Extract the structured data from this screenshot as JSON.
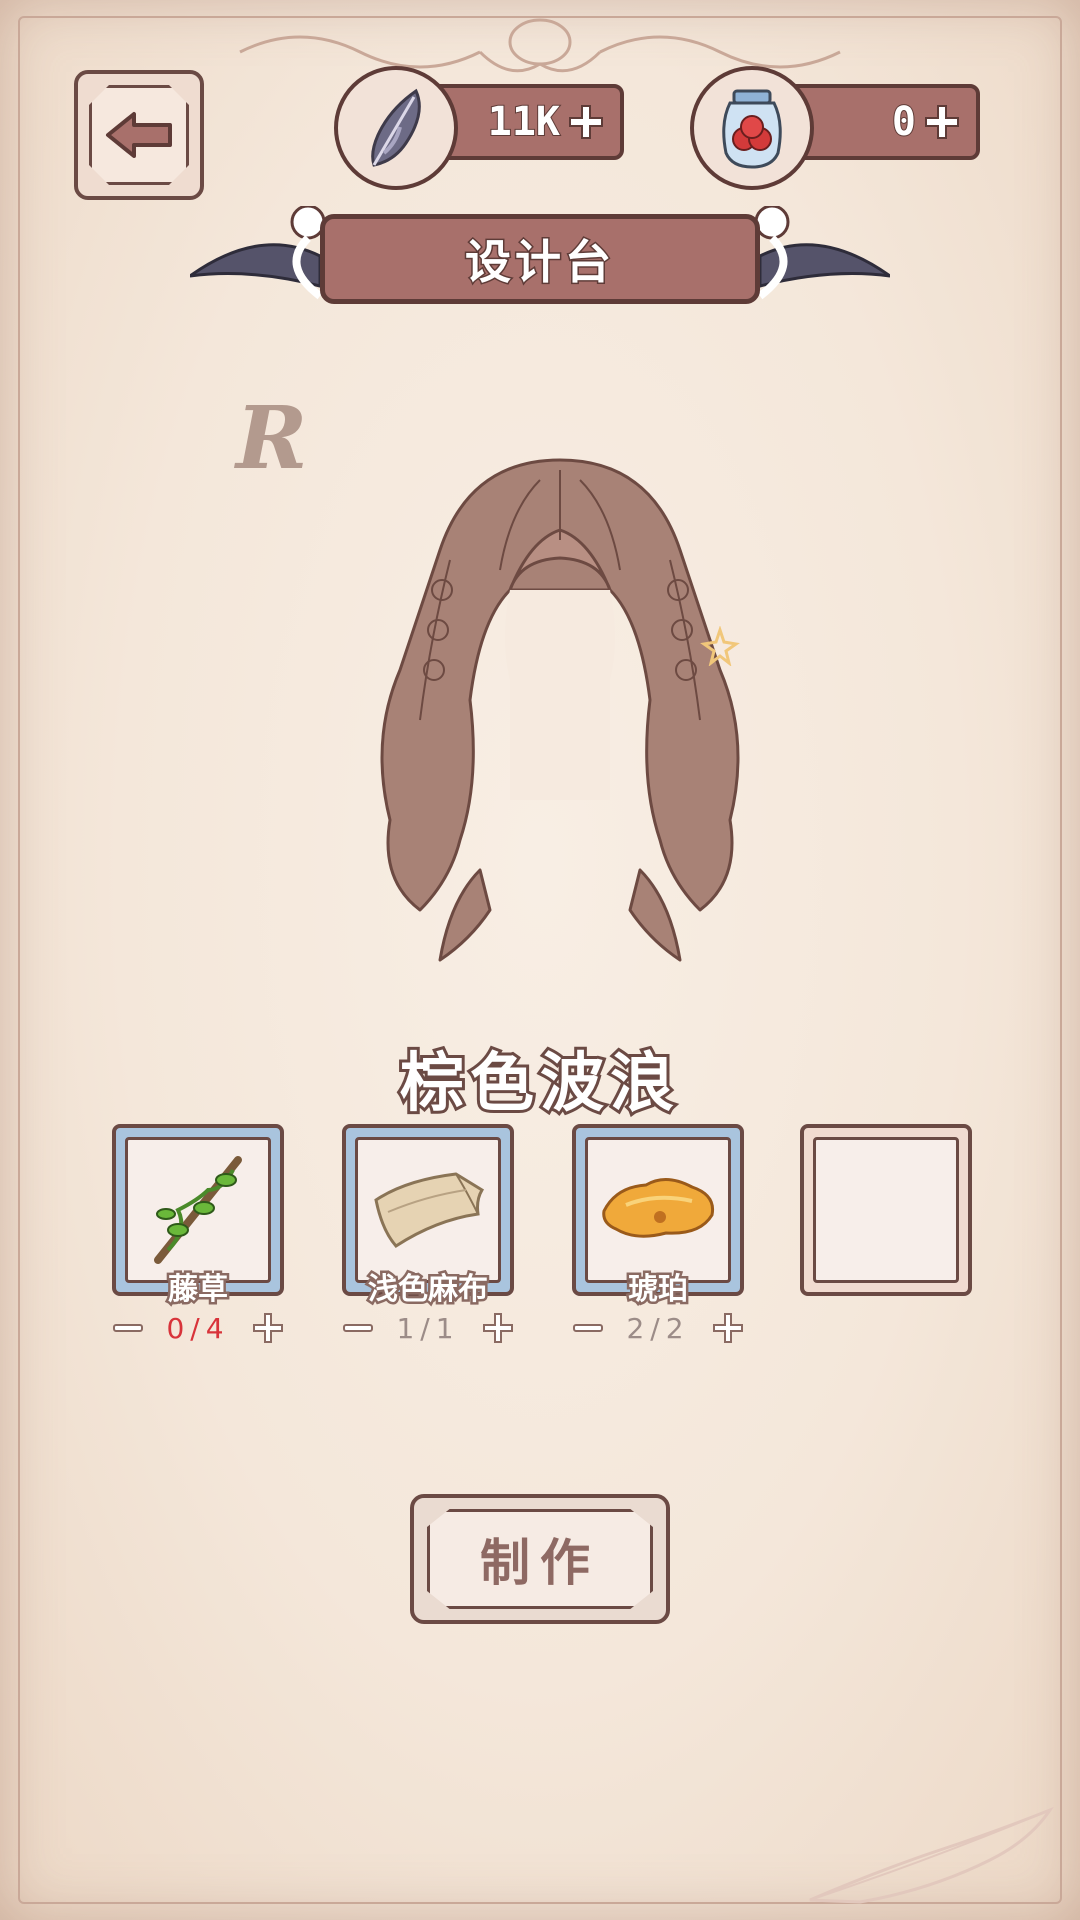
{
  "header": {
    "title": "设计台",
    "currencies": [
      {
        "icon": "feather-icon",
        "amount": "11K"
      },
      {
        "icon": "berry-jar-icon",
        "amount": "0"
      }
    ]
  },
  "design": {
    "rarity": "R",
    "item_name": "棕色波浪"
  },
  "materials": [
    {
      "name": "藤草",
      "icon": "vine-branch-icon",
      "quantity": "0/4",
      "sufficient": false
    },
    {
      "name": "浅色麻布",
      "icon": "linen-cloth-icon",
      "quantity": "1/1",
      "sufficient": true
    },
    {
      "name": "琥珀",
      "icon": "amber-icon",
      "quantity": "2/2",
      "sufficient": true
    },
    {
      "name": "",
      "icon": "",
      "quantity": "",
      "sufficient": true
    }
  ],
  "actions": {
    "make_label": "制作"
  },
  "colors": {
    "brown_border": "#5e3b37",
    "plate": "#a8706b",
    "slot_blue": "#a9c4de",
    "shortage_red": "#d8333a"
  }
}
